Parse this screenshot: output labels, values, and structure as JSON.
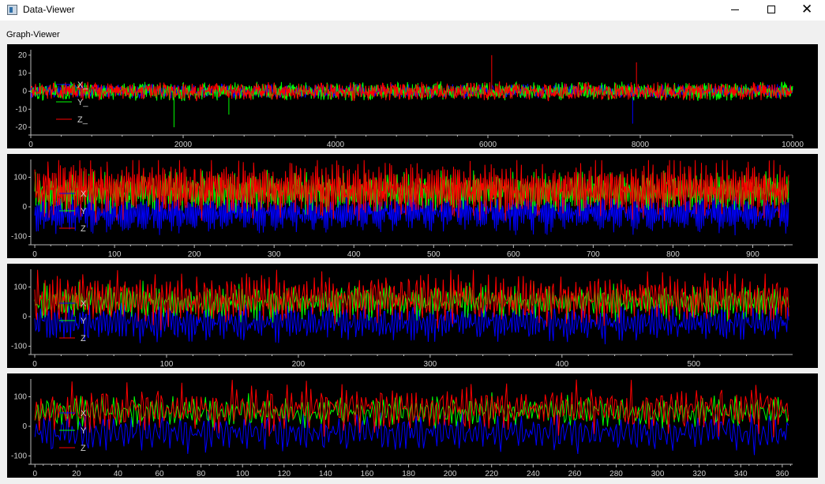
{
  "window": {
    "title": "Data-Viewer",
    "minimize_icon": "minimize-icon",
    "maximize_icon": "maximize-icon",
    "close_icon": "close-icon",
    "close_glyph": "✕"
  },
  "group_label": "Graph-Viewer",
  "chart_data": [
    {
      "type": "line",
      "title": "",
      "xlabel": "",
      "ylabel": "",
      "xlim": [
        0,
        10000
      ],
      "ylim": [
        -23,
        23
      ],
      "xticks": [
        0,
        2000,
        4000,
        6000,
        8000,
        10000
      ],
      "yticks": [
        20,
        10,
        0,
        -10,
        -20
      ],
      "grid": false,
      "legend": {
        "placement": "left",
        "entries": [
          {
            "label": "X_",
            "color": "#0000ff"
          },
          {
            "label": "Y_",
            "color": "#00ff00"
          },
          {
            "label": "Z_",
            "color": "#ff0000"
          }
        ]
      },
      "series": [
        {
          "name": "X_",
          "color": "#0000ff",
          "amplitude": 3,
          "spikes": [
            [
              7900,
              -18
            ]
          ]
        },
        {
          "name": "Y_",
          "color": "#00ff00",
          "amplitude": 4,
          "spikes": [
            [
              1880,
              -20
            ],
            [
              2600,
              -13
            ]
          ]
        },
        {
          "name": "Z_",
          "color": "#ff0000",
          "amplitude": 4,
          "spikes": [
            [
              6050,
              20
            ],
            [
              7950,
              16
            ]
          ]
        }
      ]
    },
    {
      "type": "line",
      "title": "",
      "xlabel": "",
      "ylabel": "",
      "xlim": [
        -5,
        950
      ],
      "ylim": [
        -120,
        160
      ],
      "xticks": [
        0,
        100,
        200,
        300,
        400,
        500,
        600,
        700,
        800,
        900
      ],
      "yticks": [
        100,
        0,
        -100
      ],
      "grid": false,
      "legend": {
        "placement": "left",
        "entries": [
          {
            "label": "X",
            "color": "#0000ff"
          },
          {
            "label": "Y",
            "color": "#00ff00"
          },
          {
            "label": "Z",
            "color": "#ff0000"
          }
        ]
      },
      "series": [
        {
          "name": "X",
          "color": "#0000ff",
          "center": -20,
          "amplitude": 55,
          "x_end": 945
        },
        {
          "name": "Y",
          "color": "#00ff00",
          "center": 50,
          "amplitude": 55,
          "x_end": 945
        },
        {
          "name": "Z",
          "color": "#ff0000",
          "center": 60,
          "amplitude": 80,
          "x_end": 945
        }
      ]
    },
    {
      "type": "line",
      "title": "",
      "xlabel": "",
      "ylabel": "",
      "xlim": [
        -3,
        575
      ],
      "ylim": [
        -120,
        160
      ],
      "xticks": [
        0,
        100,
        200,
        300,
        400,
        500
      ],
      "yticks": [
        100,
        0,
        -100
      ],
      "grid": false,
      "legend": {
        "placement": "left",
        "entries": [
          {
            "label": "X",
            "color": "#0000ff"
          },
          {
            "label": "Y",
            "color": "#00ff00"
          },
          {
            "label": "Z",
            "color": "#ff0000"
          }
        ]
      },
      "series": [
        {
          "name": "X",
          "color": "#0000ff",
          "center": -20,
          "amplitude": 55,
          "x_end": 572
        },
        {
          "name": "Y",
          "color": "#00ff00",
          "center": 50,
          "amplitude": 50,
          "x_end": 572
        },
        {
          "name": "Z",
          "color": "#ff0000",
          "center": 60,
          "amplitude": 75,
          "x_end": 572
        }
      ]
    },
    {
      "type": "line",
      "title": "",
      "xlabel": "",
      "ylabel": "",
      "xlim": [
        -2,
        365
      ],
      "ylim": [
        -120,
        160
      ],
      "xticks": [
        0,
        20,
        40,
        60,
        80,
        100,
        120,
        140,
        160,
        180,
        200,
        220,
        240,
        260,
        280,
        300,
        320,
        340,
        360
      ],
      "yticks": [
        100,
        0,
        -100
      ],
      "grid": false,
      "legend": {
        "placement": "left",
        "entries": [
          {
            "label": "X",
            "color": "#0000ff"
          },
          {
            "label": "Y",
            "color": "#00ff00"
          },
          {
            "label": "Z",
            "color": "#ff0000"
          }
        ]
      },
      "series": [
        {
          "name": "X",
          "color": "#0000ff",
          "center": -20,
          "amplitude": 55,
          "x_end": 363
        },
        {
          "name": "Y",
          "color": "#00ff00",
          "center": 50,
          "amplitude": 45,
          "x_end": 363
        },
        {
          "name": "Z",
          "color": "#ff0000",
          "center": 60,
          "amplitude": 70,
          "x_end": 363
        }
      ]
    }
  ]
}
